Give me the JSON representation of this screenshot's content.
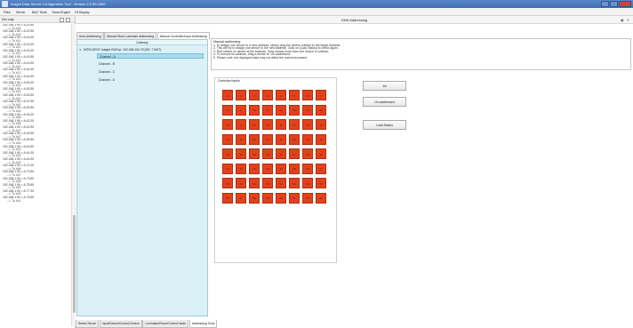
{
  "window": {
    "title": "Insight Data Server Configuration Tool - Version 2.0.89.1862"
  },
  "menu": [
    "Files",
    "Server",
    "B&C Tools",
    "Yoma Engine",
    "Of Display"
  ],
  "left_panel": {
    "header": "Dev map",
    "items": [
      [
        "192.168.1.90 > A.20.90",
        "--> Tu #42"
      ],
      [
        "192.168.1.90 > A.20.90",
        "--> Tu #42"
      ],
      [
        "192.168.1.90 > A.43.20",
        "--> Tu #11"
      ],
      [
        "192.168.1.90 > A.43.20",
        "--> Tu #11"
      ],
      [
        "192.168.1.90 > A.43.20",
        "--> Tu #12"
      ],
      [
        "192.168.1.90 > A.43.90",
        "--> Tu #12"
      ],
      [
        "192.168.1.90 > A.43.90",
        "--> Tu #13"
      ],
      [
        "192.168.1.90 > A.44.20",
        "--> Tu #13"
      ],
      [
        "192.168.1.90 > A.44.90",
        "--> Tu #14"
      ],
      [
        "192.168.1.90 > A.53.20",
        "--> Tu #15"
      ],
      [
        "192.168.1.90 > A.53.90",
        "--> Tu #15"
      ],
      [
        "192.168.1.90 > A.53.90",
        "--> Tu #12"
      ],
      [
        "192.168.1.90 > A.37.90",
        "--> Tu #41"
      ],
      [
        "192.168.1.90 > A.30.90",
        "--> Tu #41"
      ],
      [
        "192.168.1.90 > A.30.20",
        "--> Tu #46"
      ],
      [
        "192.168.1.90 > A.42.20",
        "--> Tu #46"
      ],
      [
        "192.168.1.90 > A.42.90",
        "--> Tu #47"
      ],
      [
        "192.168.1.90 > A.45.90",
        "--> Tu #47"
      ],
      [
        "192.168.1.90 > A.49.90",
        "--> Tu #44"
      ],
      [
        "192.168.1.90 > A.43.90",
        "--> Tu #43"
      ],
      [
        "192.168.1.90 > A.44.20",
        "--> Tu #42"
      ],
      [
        "192.168.1.90 > A.44.90",
        "--> Tu #43"
      ],
      [
        "192.168.1.90 > A.72.20",
        "--> Tu #46"
      ],
      [
        "192.168.1.90 > A.73.90",
        "--> Tu #47"
      ],
      [
        "192.168.1.90 > A.73.90",
        "--> Tu #48"
      ],
      [
        "192.168.1.90 > A.75.90",
        "--> Tu #49"
      ],
      [
        "192.168.1.90 > A.77.20",
        "--> Tu #40"
      ],
      [
        "192.168.1.90 > A.78.90",
        "--> Tu #41"
      ]
    ]
  },
  "panel": {
    "title": "DNS Addressing"
  },
  "tabs": [
    "Auto Addressing",
    "Manual Slow Luminaire Addressing",
    "Manual Controller/Input Addressing"
  ],
  "tree": {
    "header": "Gateway",
    "root": "INTELGENT Insight GW3 ip: 192.168.104.79 (NS: 7 NOT)",
    "channels": [
      "Channel - A",
      "Channel - B",
      "Channel - C",
      "Channel - D"
    ]
  },
  "instructions": {
    "heading": "Manual addressing",
    "lines": [
      "1. To assign one device to a new address, simply drag the device number to the target address.",
      "2. This will try to assign one device to the new address. Click on [Load Status] to check again.",
      "3. Red means no device at the address. Gray means more than one device is collision.",
      "4. To remove its address, drag a device to 'Un-addressed'.",
      "5. Please note, the displayed data may not affect the real environment."
    ]
  },
  "grid": {
    "label": "Controller/Inputs",
    "rows": 8,
    "cols": 8,
    "cell_color": "#e2411c",
    "cells": [
      "0",
      "1",
      "2",
      "3",
      "4",
      "5",
      "6",
      "7",
      "8",
      "9",
      "10",
      "11",
      "12",
      "13",
      "14",
      "15",
      "16",
      "17",
      "18",
      "19",
      "20",
      "21",
      "22",
      "23",
      "24",
      "25",
      "26",
      "27",
      "28",
      "29",
      "30",
      "31",
      "32",
      "33",
      "34",
      "35",
      "36",
      "37",
      "38",
      "39",
      "40",
      "41",
      "42",
      "43",
      "44",
      "45",
      "46",
      "47",
      "48",
      "49",
      "50",
      "51",
      "52",
      "53",
      "54",
      "55",
      "56",
      "57",
      "58",
      "59",
      "60",
      "61",
      "62",
      "63"
    ]
  },
  "buttons": {
    "all": "All",
    "unaddressed": "Un-addressed",
    "load_status": "Load Status"
  },
  "bottom_tabs": [
    "Select Server",
    "Input/Device/Control Device",
    "Luminaire/Room/Control Node",
    "Addressing Tools"
  ],
  "colors": {
    "titlebar": "#3f6fb4",
    "tree_bg": "#d9f1f7",
    "cell_fill": "#e2411c"
  }
}
